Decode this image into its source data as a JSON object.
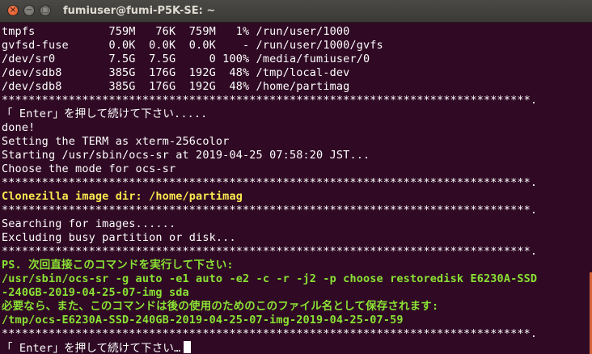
{
  "window": {
    "title": "fumiuser@fumi-P5K-SE: ~"
  },
  "terminal": {
    "lines": [
      {
        "text": "tmpfs           759M   76K  759M   1% /run/user/1000",
        "style": "normal"
      },
      {
        "text": "gvfsd-fuse      0.0K  0.0K  0.0K    - /run/user/1000/gvfs",
        "style": "normal"
      },
      {
        "text": "/dev/sr0        7.5G  7.5G     0 100% /media/fumiuser/0",
        "style": "normal"
      },
      {
        "text": "/dev/sdb8       385G  176G  192G  48% /tmp/local-dev",
        "style": "normal"
      },
      {
        "text": "/dev/sdb8       385G  176G  192G  48% /home/partimag",
        "style": "normal"
      },
      {
        "text": "*******************************************************************************.",
        "style": "normal"
      },
      {
        "text": "「 Enter」を押して続けて下さい.....",
        "style": "normal"
      },
      {
        "text": "done!",
        "style": "normal"
      },
      {
        "text": "Setting the TERM as xterm-256color",
        "style": "normal"
      },
      {
        "text": "Starting /usr/sbin/ocs-sr at 2019-04-25 07:58:20 JST...",
        "style": "normal"
      },
      {
        "text": "Choose the mode for ocs-sr",
        "style": "normal"
      },
      {
        "text": "*******************************************************************************.",
        "style": "normal"
      },
      {
        "text": "Clonezilla image dir: /home/partimag",
        "style": "yellow"
      },
      {
        "text": "*******************************************************************************.",
        "style": "normal"
      },
      {
        "text": "Searching for images......",
        "style": "normal"
      },
      {
        "text": "Excluding busy partition or disk...",
        "style": "normal"
      },
      {
        "text": "*******************************************************************************.",
        "style": "normal"
      },
      {
        "text": "PS. 次回直接このコマンドを実行して下さい:",
        "style": "green"
      },
      {
        "text": "/usr/sbin/ocs-sr -g auto -e1 auto -e2 -c -r -j2 -p choose restoredisk E6230A-SSD",
        "style": "green"
      },
      {
        "text": "-240GB-2019-04-25-07-img sda",
        "style": "green"
      },
      {
        "text": "必要なら、また、このコマンドは後の使用のためのこのファイル名として保存されます:",
        "style": "green"
      },
      {
        "text": "/tmp/ocs-E6230A-SSD-240GB-2019-04-25-07-img-2019-04-25-07-59",
        "style": "green"
      },
      {
        "text": "*******************************************************************************.",
        "style": "normal"
      },
      {
        "text": "「 Enter」を押して続けて下さい…",
        "style": "normal"
      }
    ]
  },
  "colors": {
    "background": "#300a24",
    "text": "#ffffff",
    "highlight_yellow": "#fce94f",
    "highlight_green": "#8ae234"
  },
  "icons": {
    "close": "close-icon",
    "minimize": "minimize-icon",
    "maximize": "maximize-icon"
  }
}
